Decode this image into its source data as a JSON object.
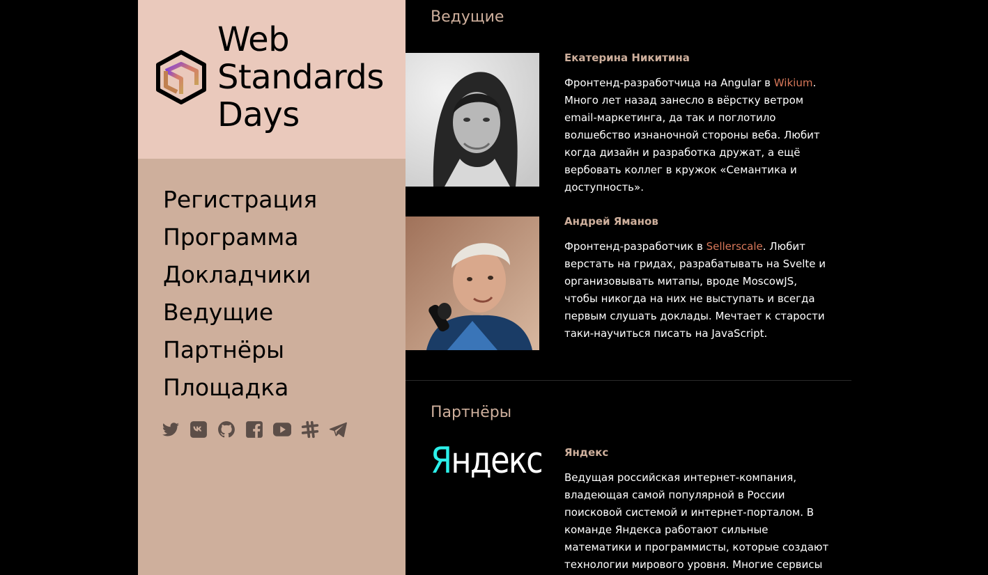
{
  "logo": {
    "line1": "Web",
    "line2": "Standards",
    "line3": "Days"
  },
  "nav": [
    {
      "label": "Регистрация"
    },
    {
      "label": "Программа"
    },
    {
      "label": "Докладчики"
    },
    {
      "label": "Ведущие"
    },
    {
      "label": "Партнёры"
    },
    {
      "label": "Площадка"
    }
  ],
  "socials": [
    "twitter-icon",
    "vk-icon",
    "github-icon",
    "facebook-icon",
    "youtube-icon",
    "slack-icon",
    "telegram-icon"
  ],
  "colors": {
    "sidebar": "#ceaf9c",
    "logo_bg": "#eac9bc",
    "accent": "#ceaf9c",
    "link": "#d8785a",
    "yandex": "#2cf0ea"
  },
  "hosts": {
    "title": "Ведущие",
    "people": [
      {
        "name": "Екатерина Никитина",
        "bio_before": "Фронтенд-разработчица на Angular в ",
        "link": "Wikium",
        "bio_after": ". Много лет назад занесло в вёрстку ветром email-маркетинга, да так и поглотило волшебство изнаночной стороны веба. Любит когда дизайн и разработка дружат, а ещё вербовать коллег в кружок «Семантика и доступность»."
      },
      {
        "name": "Андрей Яманов",
        "bio_before": "Фронтенд-разработчик в ",
        "link": "Sellerscale",
        "bio_after": ". Любит верстать на гридах, разрабатывать на Svelte и организовывать митапы, вроде MoscowJS, чтобы никогда на них не выступать и всегда первым слушать доклады. Мечтает к старости таки-научиться писать на JavaScript."
      }
    ]
  },
  "partners": {
    "title": "Партнёры",
    "items": [
      {
        "logo_first": "Я",
        "logo_rest": "ндекс",
        "name": "Яндекс",
        "text": "Ведущая российская интернет-компания, владеющая самой популярной в России поисковой системой и интернет-порталом. В команде Яндекса работают сильные математики и программисты, которые создают технологии мирового уровня. Многие сервисы"
      }
    ]
  }
}
